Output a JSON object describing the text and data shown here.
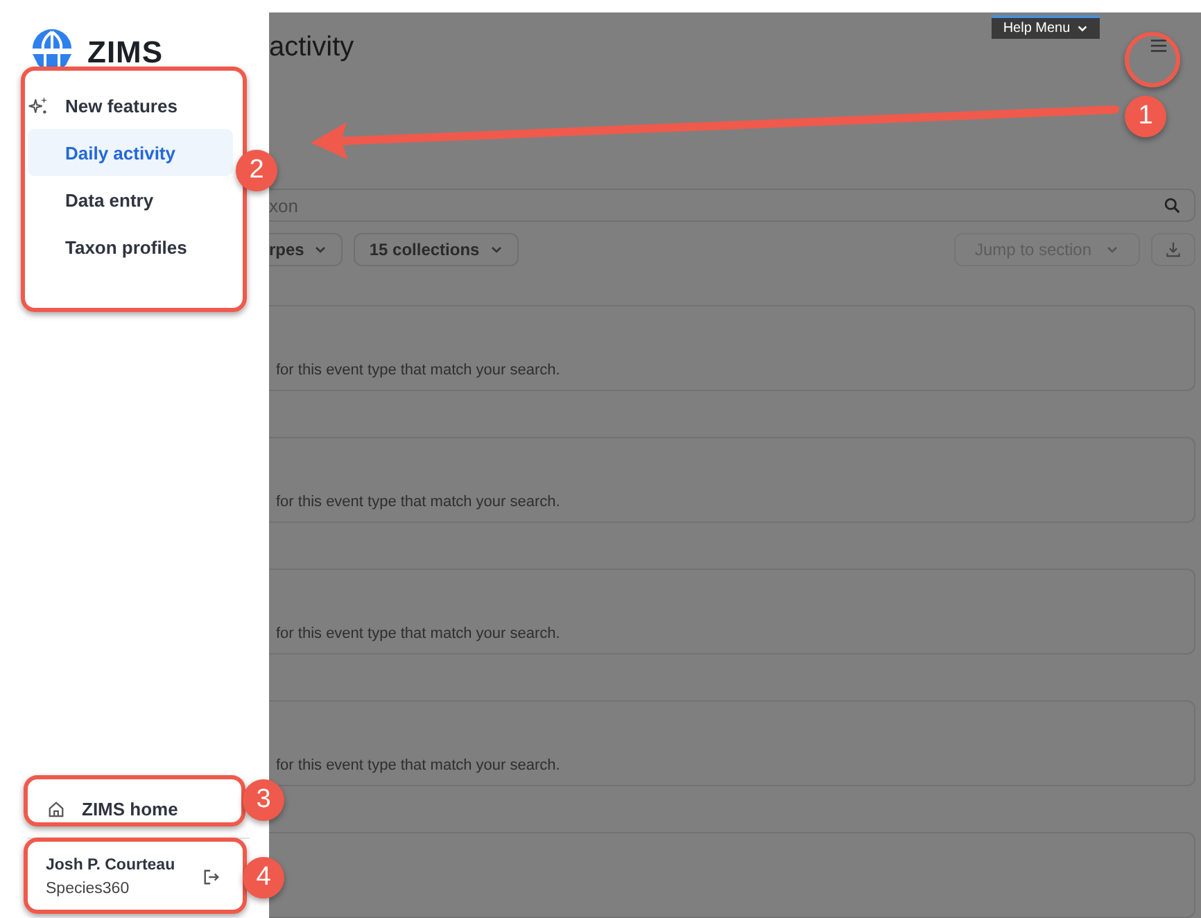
{
  "sidebar": {
    "logo": "ZIMS",
    "nav": [
      {
        "label": "New features",
        "kind": "feature",
        "selected": false
      },
      {
        "label": "Daily activity",
        "kind": "link",
        "selected": true
      },
      {
        "label": "Data entry",
        "kind": "link",
        "selected": false
      },
      {
        "label": "Taxon profiles",
        "kind": "link",
        "selected": false
      }
    ],
    "home": "ZIMS home",
    "user": {
      "name": "Josh P. Courteau",
      "org": "Species360"
    }
  },
  "help_menu": "Help Menu",
  "page": {
    "title": "activity",
    "search": {
      "value": "xon"
    },
    "filters": [
      "rpes",
      "15 collections"
    ],
    "jump": {
      "label": "Jump to section",
      "disabled": true
    },
    "cards": [
      {
        "kind": "message",
        "message": "for this event type that match your search."
      },
      {
        "kind": "message",
        "message": "for this event type that match your search."
      },
      {
        "kind": "message",
        "message": "for this event type that match your search."
      },
      {
        "kind": "message",
        "message": "for this event type that match your search."
      },
      {
        "kind": "blank"
      }
    ]
  },
  "annotations": [
    {
      "number": "1"
    },
    {
      "number": "2"
    },
    {
      "number": "3"
    },
    {
      "number": "4"
    }
  ]
}
